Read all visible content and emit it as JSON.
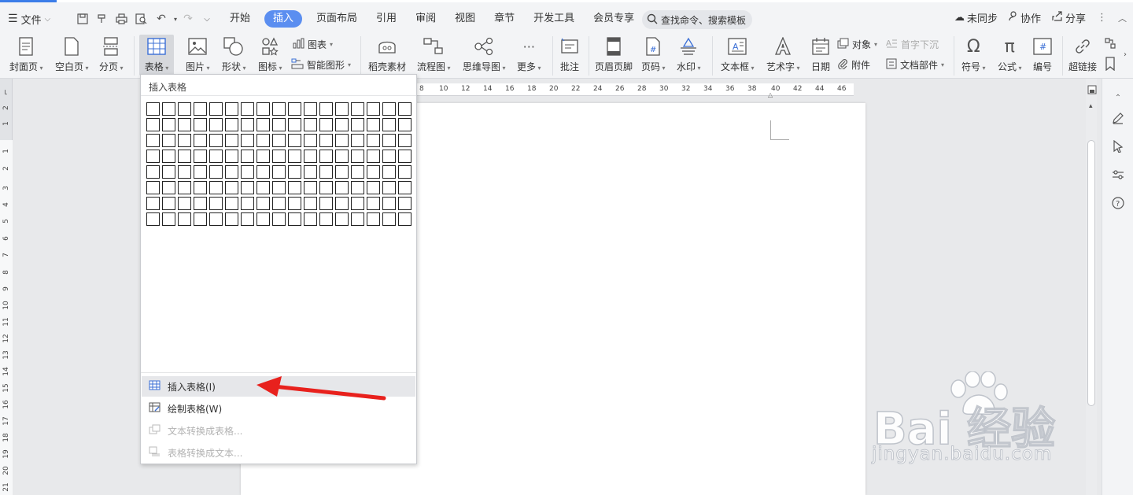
{
  "topbar": {
    "file_label": "文件",
    "tabs": [
      "开始",
      "插入",
      "页面布局",
      "引用",
      "审阅",
      "视图",
      "章节",
      "开发工具",
      "会员专享"
    ],
    "active_tab": "插入",
    "search_placeholder": "查找命令、搜索模板",
    "sync_label": "未同步",
    "collab_label": "协作",
    "share_label": "分享"
  },
  "ribbon": {
    "cover_page": "封面页",
    "blank_page": "空白页",
    "page_break": "分页",
    "table": "表格",
    "picture": "图片",
    "shape": "形状",
    "icon": "图标",
    "chart": "图表",
    "smart_art": "智能图形",
    "docer_material": "稻壳素材",
    "flowchart": "流程图",
    "mindmap": "思维导图",
    "more": "更多",
    "comment": "批注",
    "header_footer": "页眉页脚",
    "page_number": "页码",
    "watermark": "水印",
    "textbox": "文本框",
    "wordart": "艺术字",
    "date": "日期",
    "object": "对象",
    "attachment": "附件",
    "drop_cap": "首字下沉",
    "doc_parts": "文档部件",
    "symbol": "符号",
    "formula": "公式",
    "numbering": "编号",
    "hyperlink": "超链接"
  },
  "ruler": {
    "top": [
      "8",
      "10",
      "12",
      "14",
      "16",
      "18",
      "20",
      "22",
      "24",
      "26",
      "28",
      "30",
      "32",
      "34",
      "36",
      "38",
      "40",
      "42",
      "44",
      "46"
    ],
    "left": [
      "2",
      "1",
      "1",
      "2",
      "3",
      "4",
      "5",
      "6",
      "7",
      "8",
      "9",
      "10",
      "11",
      "12",
      "13",
      "14",
      "15",
      "16",
      "17",
      "18",
      "19",
      "20",
      "21"
    ]
  },
  "dropdown": {
    "title": "插入表格",
    "grid_cols": 17,
    "grid_rows": 8,
    "items": [
      {
        "label": "插入表格(I)",
        "enabled": true,
        "highlighted": true
      },
      {
        "label": "绘制表格(W)",
        "enabled": true,
        "highlighted": false
      },
      {
        "label": "文本转换成表格...",
        "enabled": false,
        "highlighted": false
      },
      {
        "label": "表格转换成文本...",
        "enabled": false,
        "highlighted": false
      }
    ]
  },
  "watermark": {
    "logo_text": "Bai 经验",
    "site": "jingyan.baidu.com"
  },
  "colors": {
    "accent": "#5b8ef0",
    "annotation_arrow": "#e8211d"
  }
}
